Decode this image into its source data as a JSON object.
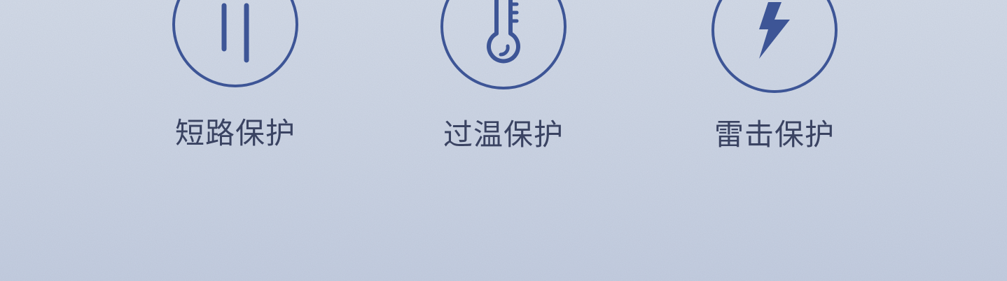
{
  "colors": {
    "icon_stroke": "#3d5596",
    "label_text": "#3a4362"
  },
  "features": [
    {
      "icon": "short-circuit-icon",
      "label": "短路保护"
    },
    {
      "icon": "thermometer-icon",
      "label": "过温保护"
    },
    {
      "icon": "lightning-icon",
      "label": "雷击保护"
    }
  ]
}
